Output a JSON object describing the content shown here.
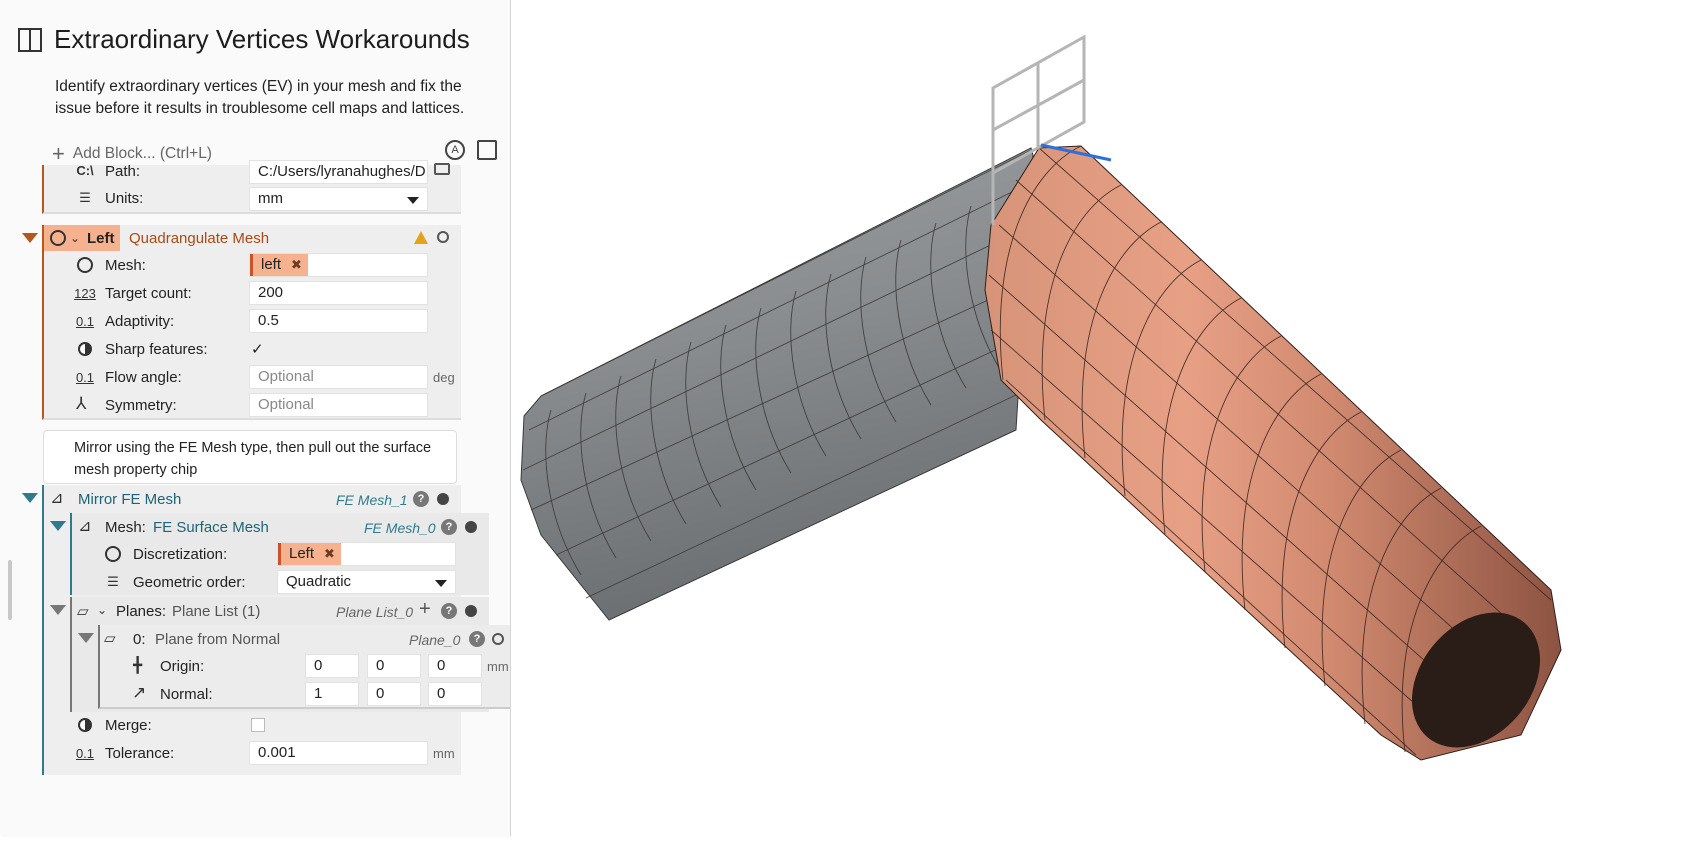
{
  "panel": {
    "title": "Extraordinary Vertices Workarounds",
    "description": "Identify extraordinary vertices (EV) in your mesh and fix the issue before it results in troublesome cell maps and lattices.",
    "add_block": "Add Block... (Ctrl+L)"
  },
  "import_block": {
    "path_label": "Path:",
    "path_value": "C:/Users/lyranahughes/D",
    "units_label": "Units:",
    "units_value": "mm"
  },
  "quad_block": {
    "name": "Left",
    "type": "Quadrangulate Mesh",
    "mesh_label": "Mesh:",
    "mesh_chip": "left",
    "target_label": "Target count:",
    "target_value": "200",
    "adaptivity_label": "Adaptivity:",
    "adaptivity_value": "0.5",
    "sharp_label": "Sharp features:",
    "sharp_check": "✓",
    "flow_label": "Flow angle:",
    "flow_placeholder": "Optional",
    "flow_unit": "deg",
    "symmetry_label": "Symmetry:",
    "symmetry_placeholder": "Optional"
  },
  "comment": "Mirror using the FE Mesh type, then pull out the surface mesh property chip",
  "mirror_block": {
    "title": "Mirror FE Mesh",
    "name": "FE Mesh_1",
    "mesh_label": "Mesh:",
    "mesh_type": "FE Surface Mesh",
    "mesh_name": "FE Mesh_0",
    "discretization_label": "Discretization:",
    "discretization_chip": "Left",
    "geometric_label": "Geometric order:",
    "geometric_value": "Quadratic",
    "planes_label": "Planes:",
    "planes_type": "Plane List (1)",
    "planes_name": "Plane List_0",
    "plane_index": "0:",
    "plane_type": "Plane from Normal",
    "plane_name": "Plane_0",
    "origin_label": "Origin:",
    "origin": [
      "0",
      "0",
      "0"
    ],
    "origin_unit": "mm",
    "normal_label": "Normal:",
    "normal": [
      "1",
      "0",
      "0"
    ],
    "merge_label": "Merge:",
    "tolerance_label": "Tolerance:",
    "tolerance_value": "0.001",
    "tolerance_unit": "mm"
  },
  "icons": {
    "path": "C:\\",
    "number": "123",
    "decimal": "0.1",
    "question": "?",
    "warning": "!"
  },
  "colors": {
    "accent_orange": "#b4581f",
    "chip_orange": "#f6b28f",
    "teal": "#2f7b8c",
    "mesh_gray": "#8d9092",
    "mesh_copper": "#c98a74"
  }
}
